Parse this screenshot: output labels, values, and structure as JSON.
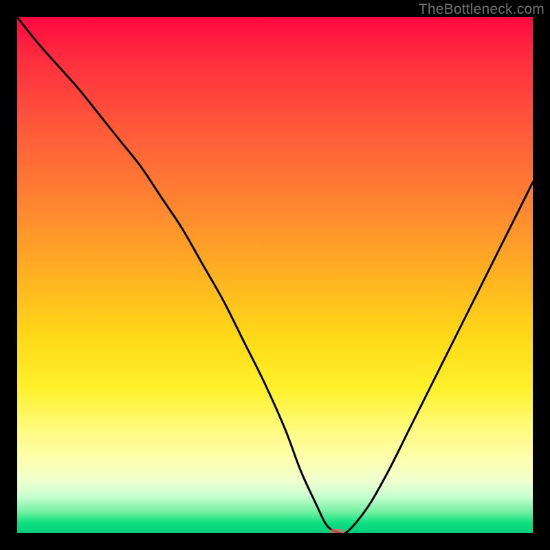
{
  "watermark": "TheBottleneck.com",
  "chart_data": {
    "type": "line",
    "title": "",
    "xlabel": "",
    "ylabel": "",
    "xlim": [
      0,
      100
    ],
    "ylim": [
      0,
      100
    ],
    "marker": {
      "x": 62,
      "y": 0
    },
    "x": [
      0,
      4,
      8,
      12,
      16,
      20,
      24,
      28,
      32,
      36,
      40,
      44,
      48,
      52,
      55,
      58,
      60,
      62,
      64,
      68,
      72,
      76,
      80,
      84,
      88,
      92,
      96,
      100
    ],
    "y": [
      100,
      95,
      90.5,
      86,
      81,
      76,
      71,
      65,
      59,
      52,
      45,
      37,
      29,
      20,
      12,
      5.5,
      1.5,
      0.2,
      0.2,
      5,
      12,
      20,
      28,
      36,
      44,
      52,
      60,
      68
    ],
    "background_gradient": {
      "top": "#ff0840",
      "mid": "#ffd917",
      "bottom": "#00d07a"
    },
    "marker_color": "#e26a6a"
  }
}
